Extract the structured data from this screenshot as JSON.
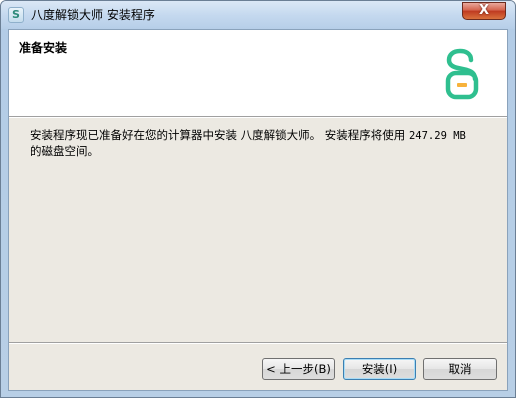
{
  "window": {
    "title": "八度解锁大师 安装程序",
    "app_icon_glyph": "S",
    "close_glyph": "X"
  },
  "header": {
    "title": "准备安装",
    "logo_icon": "unlock-s-logo-icon",
    "logo_colors": {
      "teal": "#2fbf8f",
      "orange": "#f7b23b"
    }
  },
  "body": {
    "text_prefix": "安装程序现已准备好在您的计算器中安装 八度解锁大师。 安装程序将使用 ",
    "size_value": "247.29 MB",
    "text_suffix": "的磁盘空间。"
  },
  "buttons": {
    "back_label": "< 上一步(B)",
    "install_label": "安装(I)",
    "cancel_label": "取消"
  }
}
